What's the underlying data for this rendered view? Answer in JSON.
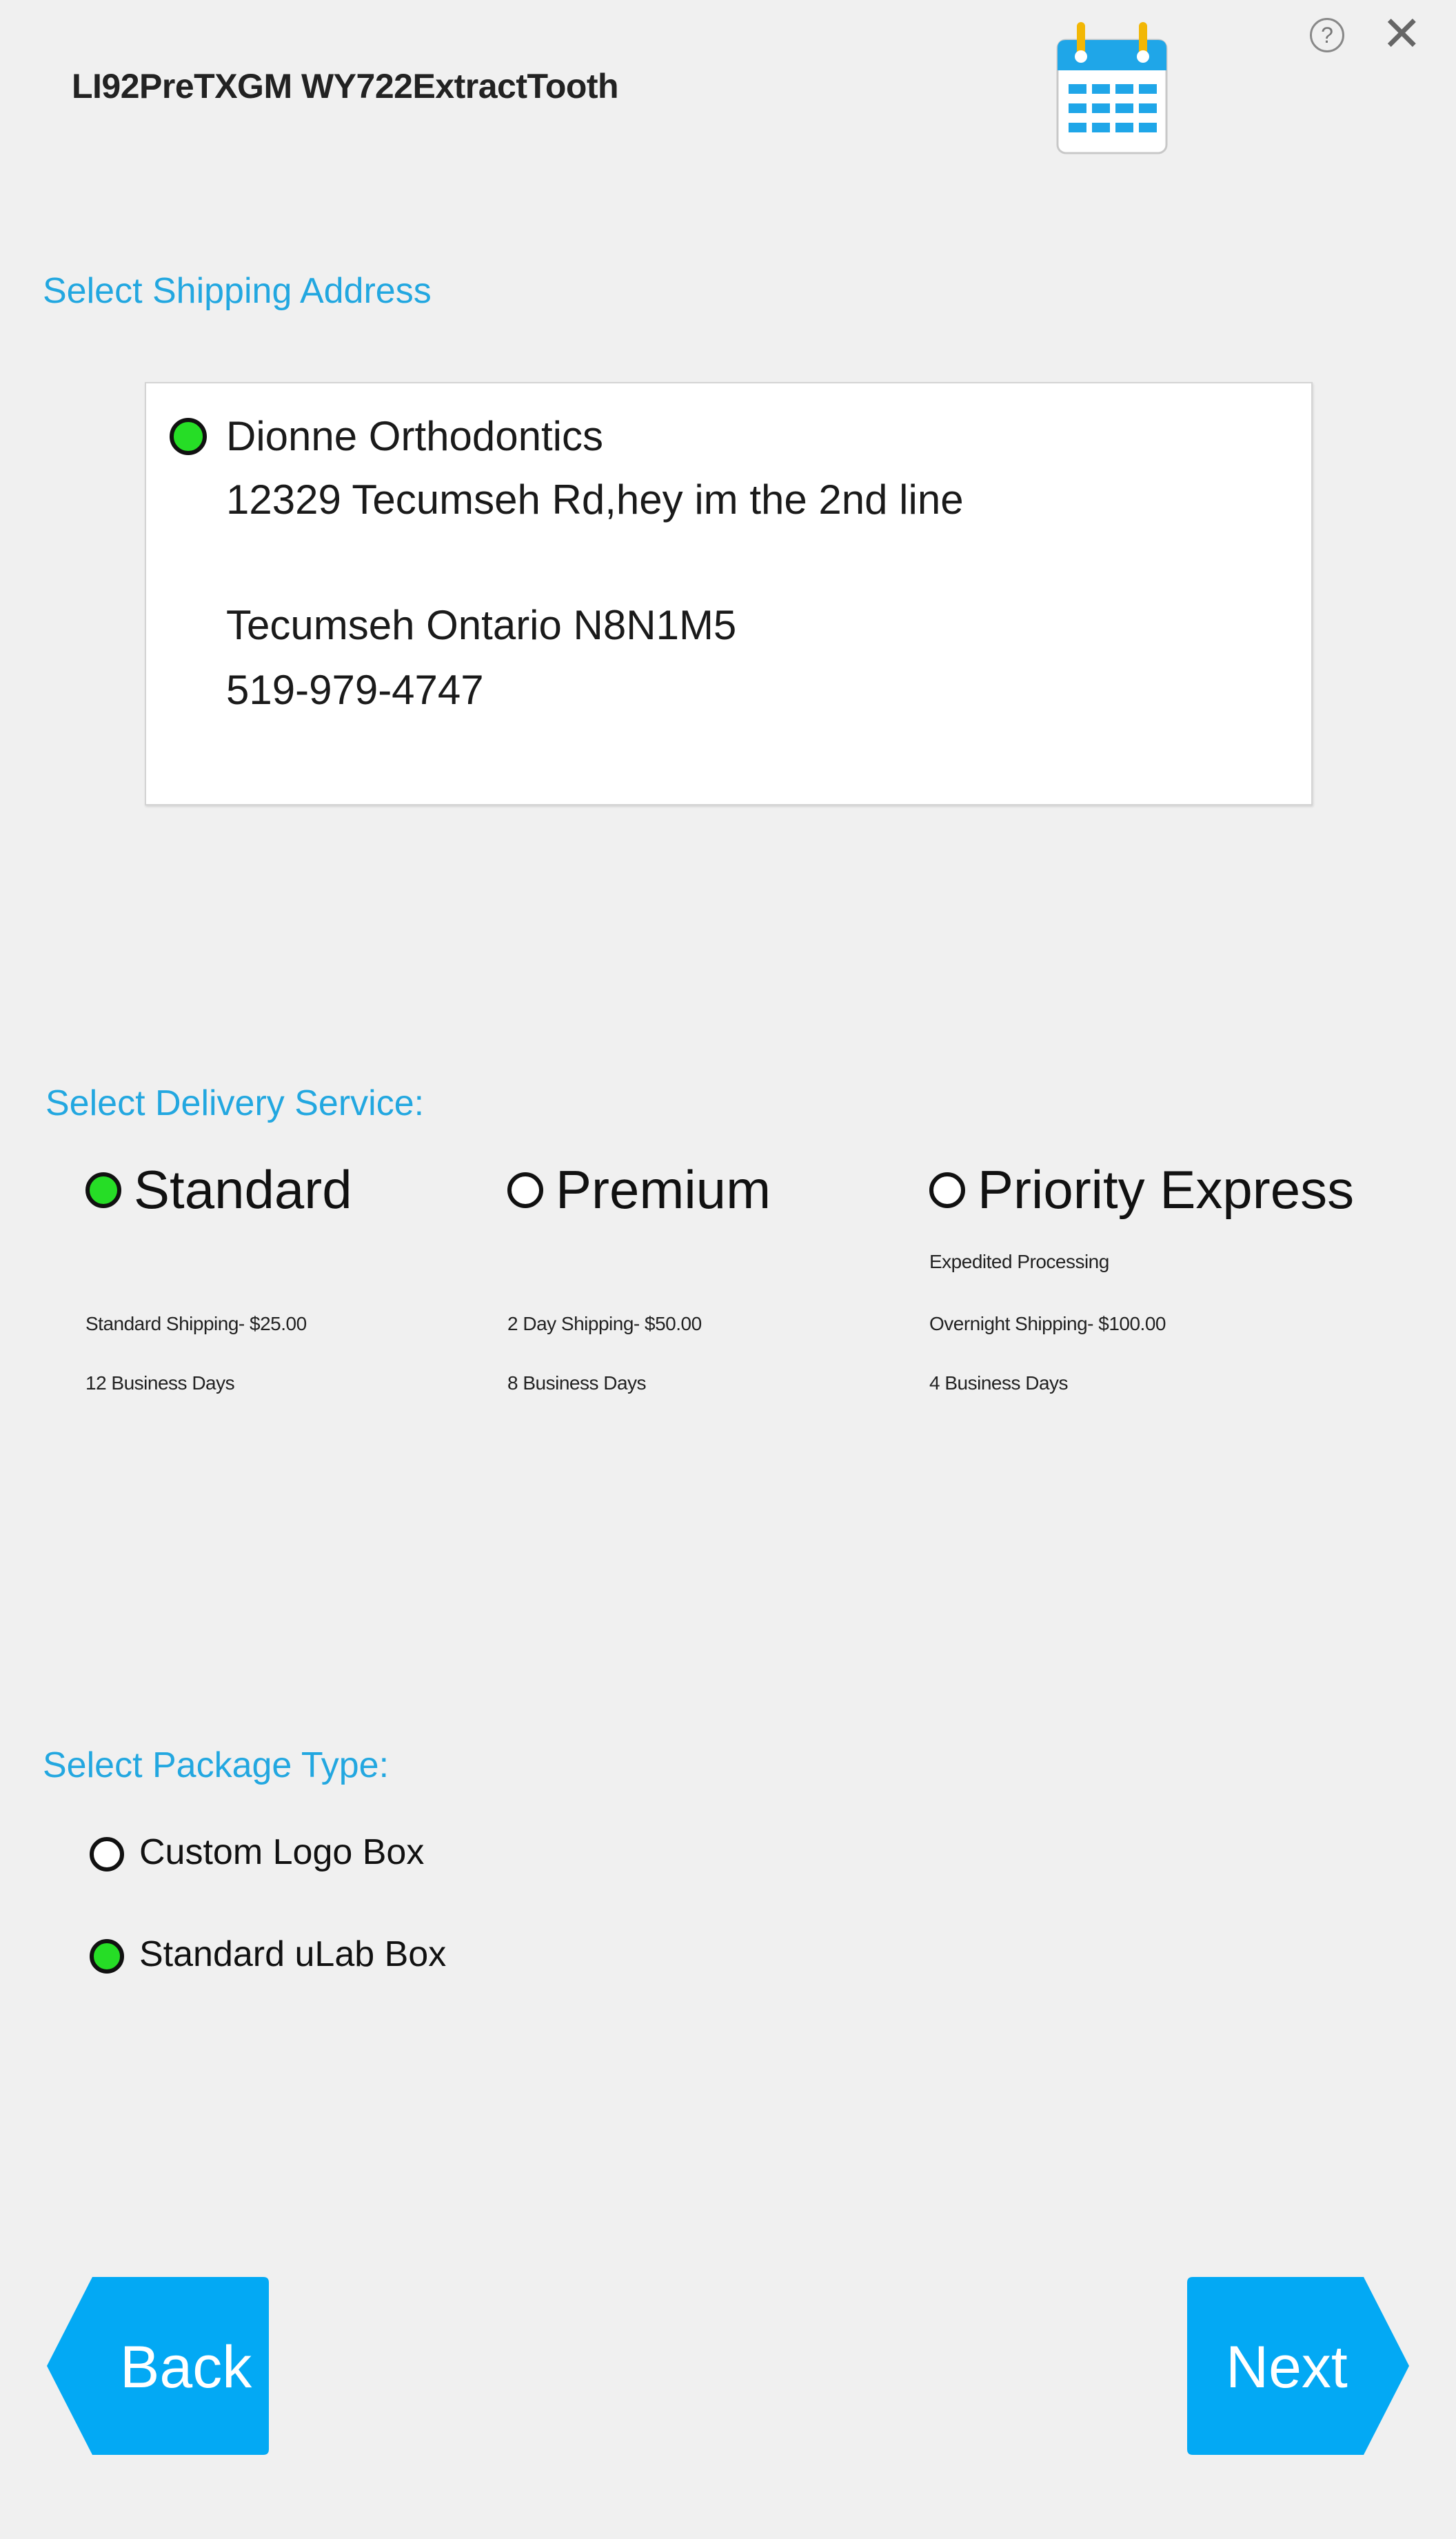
{
  "header": {
    "title": "LI92PreTXGM WY722ExtractTooth",
    "help_glyph": "?",
    "close_glyph": "✕",
    "calendar_icon": "calendar-icon"
  },
  "shipping": {
    "label": "Select Shipping Address",
    "address": {
      "selected": true,
      "name": "Dionne Orthodontics",
      "line1": "12329 Tecumseh Rd,hey im the 2nd line",
      "city_line": "Tecumseh Ontario N8N1M5",
      "phone": "519-979-4747"
    }
  },
  "delivery": {
    "label": "Select Delivery Service:",
    "options": [
      {
        "name": "Standard",
        "selected": true,
        "note": "",
        "price": "Standard Shipping- $25.00",
        "days": "12 Business Days"
      },
      {
        "name": "Premium",
        "selected": false,
        "note": "",
        "price": "2 Day Shipping- $50.00",
        "days": "8 Business Days"
      },
      {
        "name": "Priority Express",
        "selected": false,
        "note": "Expedited Processing",
        "price": "Overnight Shipping- $100.00",
        "days": "4 Business Days"
      }
    ]
  },
  "package": {
    "label": "Select Package Type:",
    "options": [
      {
        "name": "Custom Logo Box",
        "selected": false
      },
      {
        "name": "Standard uLab Box",
        "selected": true
      }
    ]
  },
  "nav": {
    "back_label": "Back",
    "next_label": "Next"
  },
  "colors": {
    "accent": "#22a7e0",
    "button": "#03a9f4",
    "radio_selected": "#26dd26"
  }
}
